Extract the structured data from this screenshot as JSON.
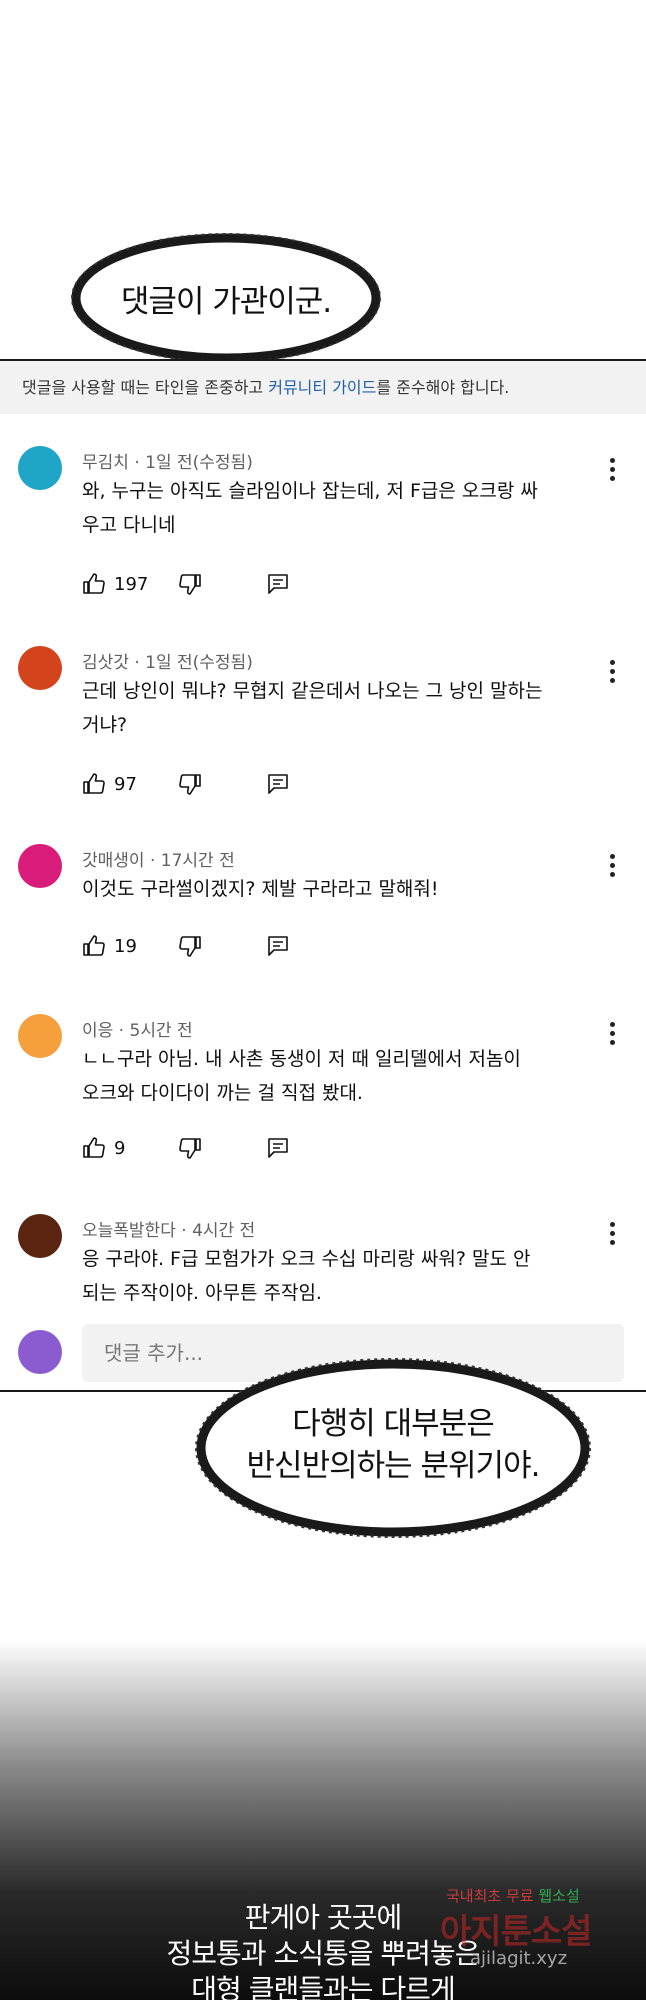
{
  "bubble_top": {
    "text": "댓글이 가관이군."
  },
  "notice": {
    "before": "댓글을 사용할 때는 타인을 존중하고 ",
    "link": "커뮤니티 가이드",
    "after": "를 준수해야 합니다."
  },
  "comments": [
    {
      "author": "무김치",
      "time": "1일 전(수정됨)",
      "line1": "와, 누구는 아직도 슬라임이나 잡는데, 저 F급은 오크랑 싸",
      "line2": "우고 다니네",
      "likes": "197",
      "avatar_color": "#1fa5c5"
    },
    {
      "author": "김삿갓",
      "time": "1일 전(수정됨)",
      "line1": "근데 낭인이 뭐냐? 무협지 같은데서 나오는 그 낭인 말하는",
      "line2": "거냐?",
      "likes": "97",
      "avatar_color": "#d4441c"
    },
    {
      "author": "갓매생이",
      "time": "17시간 전",
      "line1": "이것도 구라썰이겠지? 제발 구라라고 말해줘!",
      "line2": "",
      "likes": "19",
      "avatar_color": "#d91c7a"
    },
    {
      "author": "이응",
      "time": "5시간 전",
      "line1": "ㄴㄴ구라 아님. 내 사촌 동생이 저 때 일리델에서 저놈이",
      "line2": "오크와 다이다이 까는 걸 직접 봤대.",
      "likes": "9",
      "avatar_color": "#f5a03c"
    },
    {
      "author": "오늘폭발한다",
      "time": "4시간 전",
      "line1": "응 구라야. F급 모험가가 오크 수십 마리랑 싸워? 말도 안",
      "line2": "되는 주작이야. 아무튼 주작임.",
      "likes": "",
      "avatar_color": "#5a2410"
    }
  ],
  "add_comment": {
    "placeholder": "댓글 추가...",
    "avatar_color": "#8a5ccf"
  },
  "bubble_bottom": {
    "line1": "다행히 대부분은",
    "line2": "반신반의하는 분위기야."
  },
  "narration": {
    "line1": "판게아 곳곳에",
    "line2": "정보통과 소식통을 뿌려놓은",
    "line3": "대형 클랜들과는 다르게"
  },
  "watermark": {
    "a": "국내최초 무료 ",
    "b": "웹소설",
    "c": "아지툰소설",
    "d": "ajilagit.xyz"
  }
}
